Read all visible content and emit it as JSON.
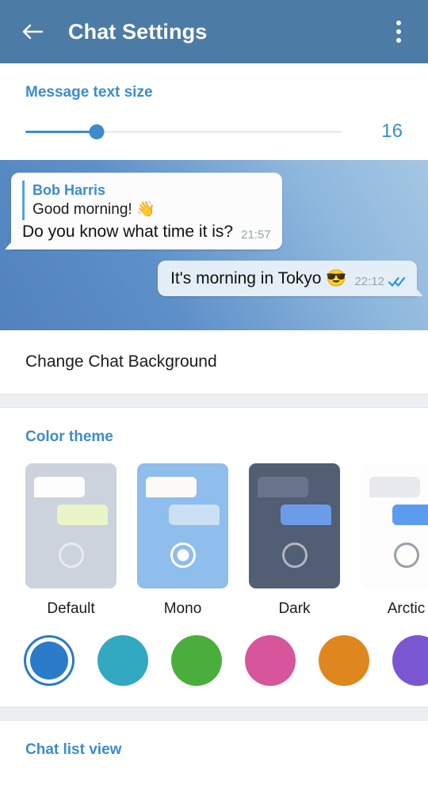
{
  "appbar": {
    "back_icon": "arrow-left-icon",
    "title": "Chat Settings",
    "overflow_icon": "more-vertical-icon"
  },
  "text_size": {
    "title": "Message text size",
    "value": "16",
    "percent": 22.5
  },
  "chat_preview": {
    "incoming": {
      "quote_name": "Bob Harris",
      "quote_text": "Good morning! 👋",
      "text": "Do you know what time it is?",
      "time": "21:57"
    },
    "outgoing": {
      "text": "It's morning in Tokyo 😎",
      "time": "22:12",
      "status_icon": "double-check-icon"
    }
  },
  "background_row": {
    "label": "Change Chat Background"
  },
  "color_theme": {
    "title": "Color theme",
    "themes": [
      {
        "label": "Default",
        "selected": false,
        "bg": "#ccd3dd",
        "bubble_in": "#fdfdfd",
        "bubble_out": "#e9f5c9"
      },
      {
        "label": "Mono",
        "selected": true,
        "bg": "#8fbdec",
        "bubble_in": "#fdfbf7",
        "bubble_out": "#cbe0f5"
      },
      {
        "label": "Dark",
        "selected": false,
        "bg": "#525e74",
        "bubble_in": "#68748a",
        "bubble_out": "#6c9ce8"
      },
      {
        "label": "Arctic",
        "selected": false,
        "bg": "#fdfdfd",
        "bubble_in": "#e7e9ee",
        "bubble_out": "#5c9cf0"
      }
    ],
    "swatches": [
      {
        "name": "blue",
        "color": "#2a7bc8",
        "selected": true
      },
      {
        "name": "teal",
        "color": "#32a9c0",
        "selected": false
      },
      {
        "name": "green",
        "color": "#4aae3c",
        "selected": false
      },
      {
        "name": "pink",
        "color": "#d6559b",
        "selected": false
      },
      {
        "name": "orange",
        "color": "#e0861f",
        "selected": false
      },
      {
        "name": "purple",
        "color": "#7a57d1",
        "selected": false
      }
    ]
  },
  "chat_list_view": {
    "title": "Chat list view"
  }
}
